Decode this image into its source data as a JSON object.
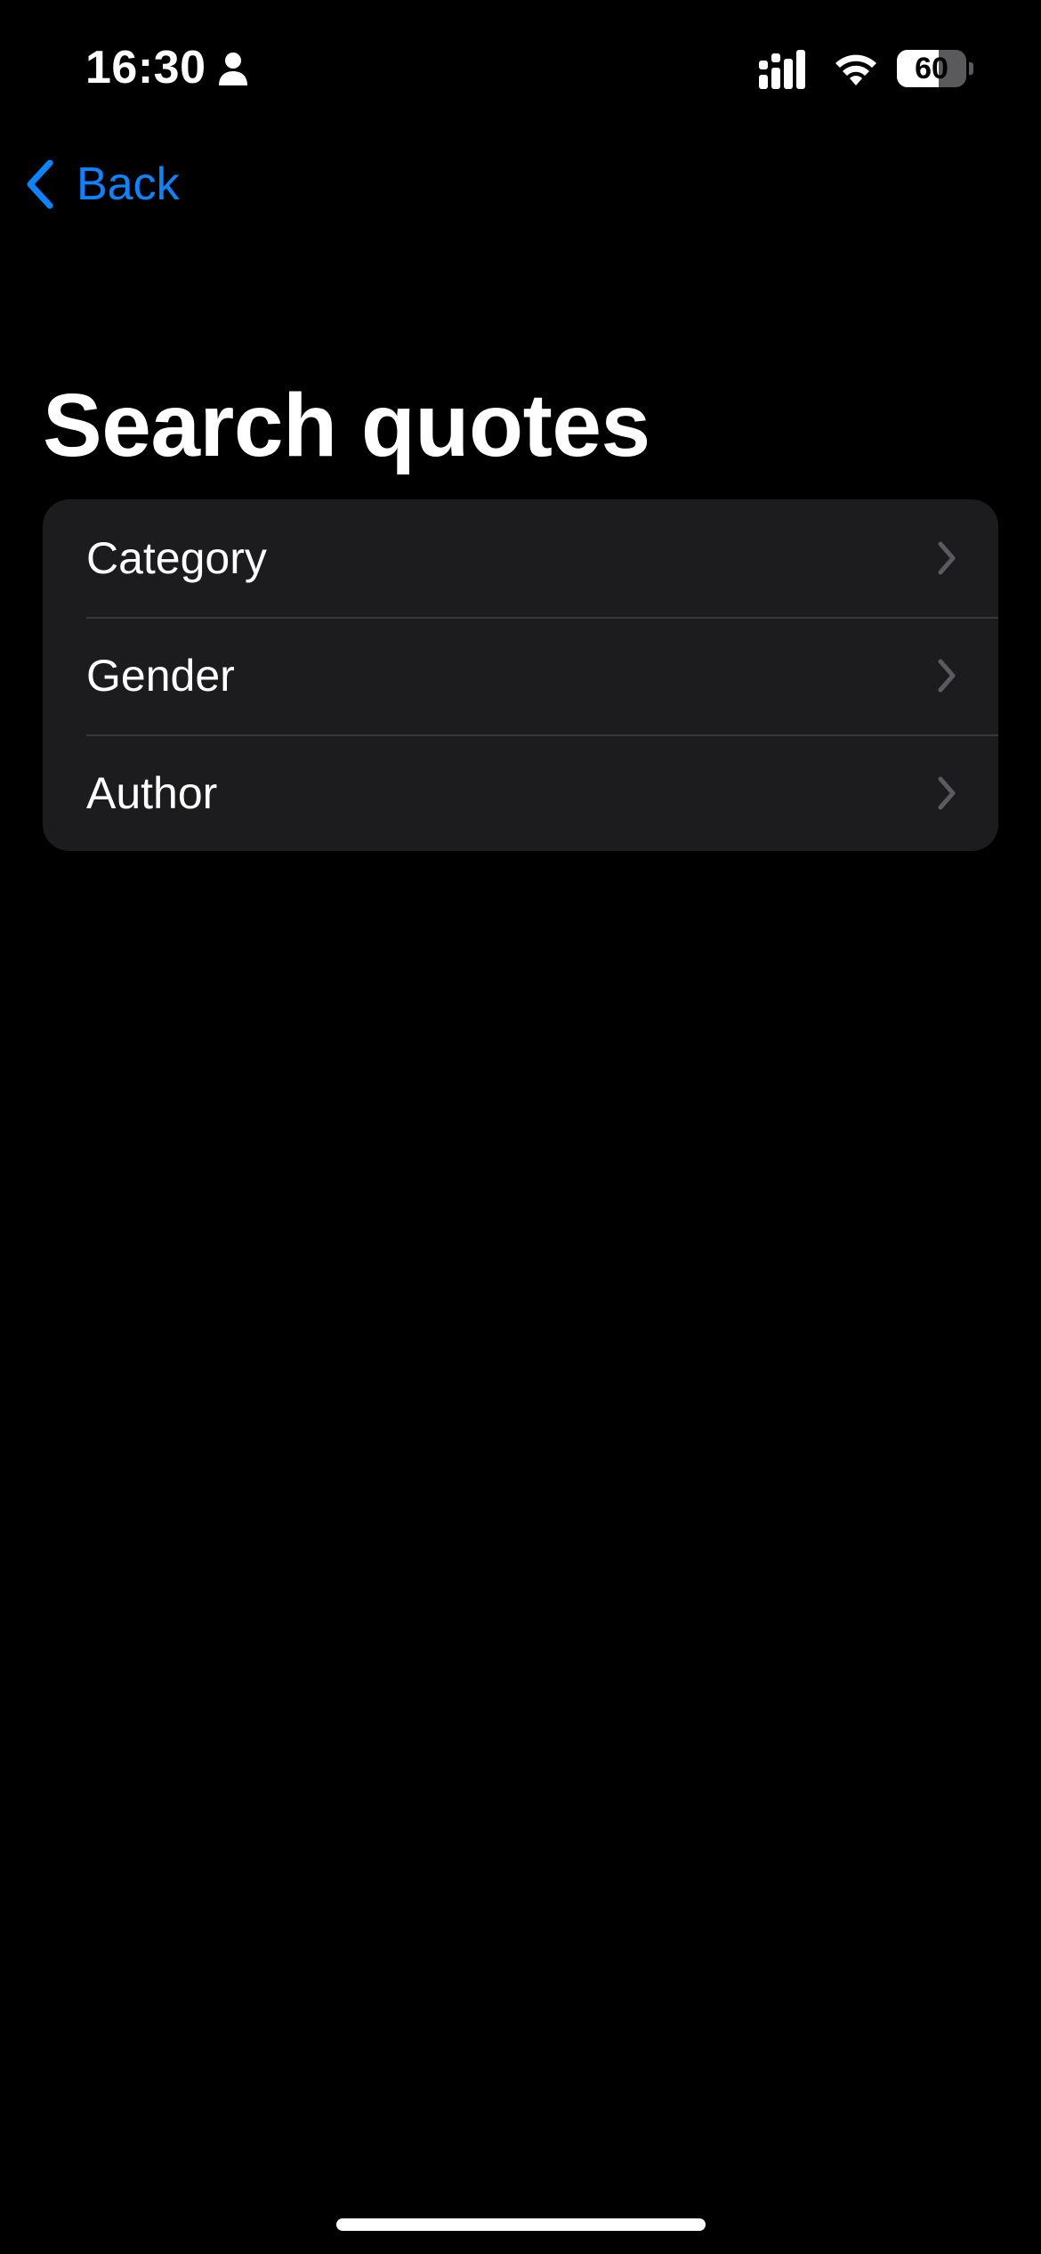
{
  "status_bar": {
    "time": "16:30",
    "battery_percent": "60",
    "battery_level": 0.6,
    "icons": [
      "person-icon",
      "signal-icon",
      "wifi-icon",
      "battery-icon"
    ]
  },
  "nav": {
    "back_label": "Back",
    "back_icon": "chevron-left-icon"
  },
  "page": {
    "title": "Search quotes"
  },
  "menu": {
    "items": [
      {
        "label": "Category",
        "icon": "chevron-right-icon"
      },
      {
        "label": "Gender",
        "icon": "chevron-right-icon"
      },
      {
        "label": "Author",
        "icon": "chevron-right-icon"
      }
    ]
  },
  "colors": {
    "background": "#000000",
    "accent": "#0a84ff",
    "card": "#1c1c1e",
    "separator": "#38383a",
    "chevron": "#5b5b5f"
  }
}
